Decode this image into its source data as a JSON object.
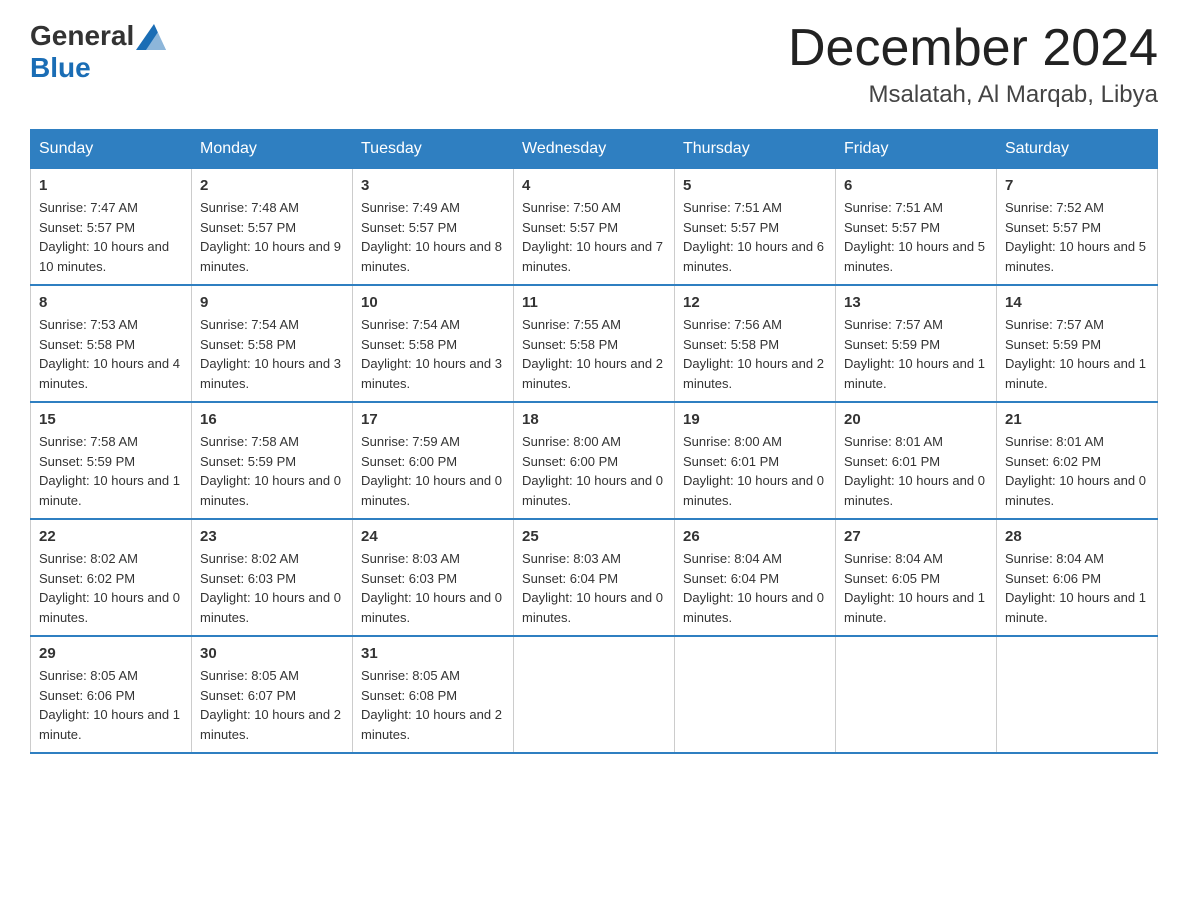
{
  "header": {
    "logo_general": "General",
    "logo_blue": "Blue",
    "month": "December 2024",
    "location": "Msalatah, Al Marqab, Libya"
  },
  "weekdays": [
    "Sunday",
    "Monday",
    "Tuesday",
    "Wednesday",
    "Thursday",
    "Friday",
    "Saturday"
  ],
  "weeks": [
    [
      {
        "day": "1",
        "sunrise": "7:47 AM",
        "sunset": "5:57 PM",
        "daylight": "10 hours and 10 minutes."
      },
      {
        "day": "2",
        "sunrise": "7:48 AM",
        "sunset": "5:57 PM",
        "daylight": "10 hours and 9 minutes."
      },
      {
        "day": "3",
        "sunrise": "7:49 AM",
        "sunset": "5:57 PM",
        "daylight": "10 hours and 8 minutes."
      },
      {
        "day": "4",
        "sunrise": "7:50 AM",
        "sunset": "5:57 PM",
        "daylight": "10 hours and 7 minutes."
      },
      {
        "day": "5",
        "sunrise": "7:51 AM",
        "sunset": "5:57 PM",
        "daylight": "10 hours and 6 minutes."
      },
      {
        "day": "6",
        "sunrise": "7:51 AM",
        "sunset": "5:57 PM",
        "daylight": "10 hours and 5 minutes."
      },
      {
        "day": "7",
        "sunrise": "7:52 AM",
        "sunset": "5:57 PM",
        "daylight": "10 hours and 5 minutes."
      }
    ],
    [
      {
        "day": "8",
        "sunrise": "7:53 AM",
        "sunset": "5:58 PM",
        "daylight": "10 hours and 4 minutes."
      },
      {
        "day": "9",
        "sunrise": "7:54 AM",
        "sunset": "5:58 PM",
        "daylight": "10 hours and 3 minutes."
      },
      {
        "day": "10",
        "sunrise": "7:54 AM",
        "sunset": "5:58 PM",
        "daylight": "10 hours and 3 minutes."
      },
      {
        "day": "11",
        "sunrise": "7:55 AM",
        "sunset": "5:58 PM",
        "daylight": "10 hours and 2 minutes."
      },
      {
        "day": "12",
        "sunrise": "7:56 AM",
        "sunset": "5:58 PM",
        "daylight": "10 hours and 2 minutes."
      },
      {
        "day": "13",
        "sunrise": "7:57 AM",
        "sunset": "5:59 PM",
        "daylight": "10 hours and 1 minute."
      },
      {
        "day": "14",
        "sunrise": "7:57 AM",
        "sunset": "5:59 PM",
        "daylight": "10 hours and 1 minute."
      }
    ],
    [
      {
        "day": "15",
        "sunrise": "7:58 AM",
        "sunset": "5:59 PM",
        "daylight": "10 hours and 1 minute."
      },
      {
        "day": "16",
        "sunrise": "7:58 AM",
        "sunset": "5:59 PM",
        "daylight": "10 hours and 0 minutes."
      },
      {
        "day": "17",
        "sunrise": "7:59 AM",
        "sunset": "6:00 PM",
        "daylight": "10 hours and 0 minutes."
      },
      {
        "day": "18",
        "sunrise": "8:00 AM",
        "sunset": "6:00 PM",
        "daylight": "10 hours and 0 minutes."
      },
      {
        "day": "19",
        "sunrise": "8:00 AM",
        "sunset": "6:01 PM",
        "daylight": "10 hours and 0 minutes."
      },
      {
        "day": "20",
        "sunrise": "8:01 AM",
        "sunset": "6:01 PM",
        "daylight": "10 hours and 0 minutes."
      },
      {
        "day": "21",
        "sunrise": "8:01 AM",
        "sunset": "6:02 PM",
        "daylight": "10 hours and 0 minutes."
      }
    ],
    [
      {
        "day": "22",
        "sunrise": "8:02 AM",
        "sunset": "6:02 PM",
        "daylight": "10 hours and 0 minutes."
      },
      {
        "day": "23",
        "sunrise": "8:02 AM",
        "sunset": "6:03 PM",
        "daylight": "10 hours and 0 minutes."
      },
      {
        "day": "24",
        "sunrise": "8:03 AM",
        "sunset": "6:03 PM",
        "daylight": "10 hours and 0 minutes."
      },
      {
        "day": "25",
        "sunrise": "8:03 AM",
        "sunset": "6:04 PM",
        "daylight": "10 hours and 0 minutes."
      },
      {
        "day": "26",
        "sunrise": "8:04 AM",
        "sunset": "6:04 PM",
        "daylight": "10 hours and 0 minutes."
      },
      {
        "day": "27",
        "sunrise": "8:04 AM",
        "sunset": "6:05 PM",
        "daylight": "10 hours and 1 minute."
      },
      {
        "day": "28",
        "sunrise": "8:04 AM",
        "sunset": "6:06 PM",
        "daylight": "10 hours and 1 minute."
      }
    ],
    [
      {
        "day": "29",
        "sunrise": "8:05 AM",
        "sunset": "6:06 PM",
        "daylight": "10 hours and 1 minute."
      },
      {
        "day": "30",
        "sunrise": "8:05 AM",
        "sunset": "6:07 PM",
        "daylight": "10 hours and 2 minutes."
      },
      {
        "day": "31",
        "sunrise": "8:05 AM",
        "sunset": "6:08 PM",
        "daylight": "10 hours and 2 minutes."
      },
      null,
      null,
      null,
      null
    ]
  ]
}
